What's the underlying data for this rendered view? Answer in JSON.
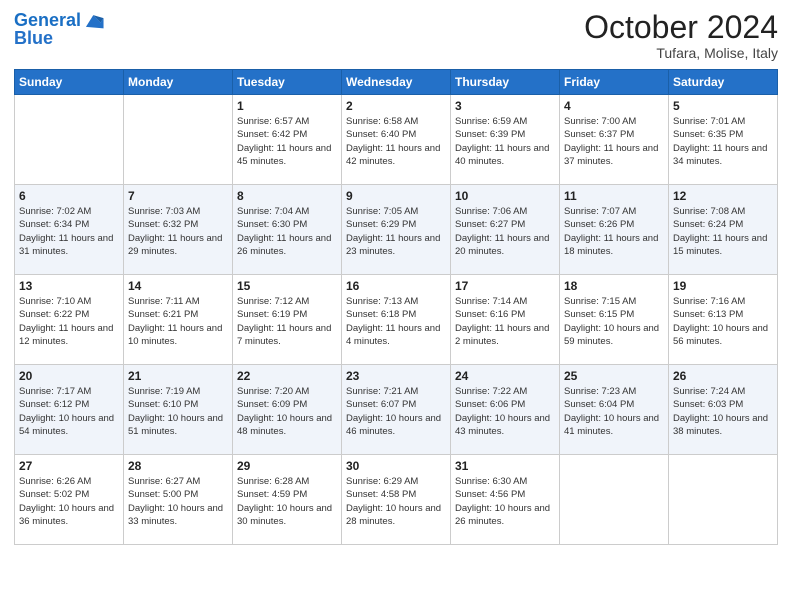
{
  "header": {
    "logo_line1": "General",
    "logo_line2": "Blue",
    "month": "October 2024",
    "location": "Tufara, Molise, Italy"
  },
  "weekdays": [
    "Sunday",
    "Monday",
    "Tuesday",
    "Wednesday",
    "Thursday",
    "Friday",
    "Saturday"
  ],
  "weeks": [
    [
      {
        "day": "",
        "sunrise": "",
        "sunset": "",
        "daylight": ""
      },
      {
        "day": "",
        "sunrise": "",
        "sunset": "",
        "daylight": ""
      },
      {
        "day": "1",
        "sunrise": "Sunrise: 6:57 AM",
        "sunset": "Sunset: 6:42 PM",
        "daylight": "Daylight: 11 hours and 45 minutes."
      },
      {
        "day": "2",
        "sunrise": "Sunrise: 6:58 AM",
        "sunset": "Sunset: 6:40 PM",
        "daylight": "Daylight: 11 hours and 42 minutes."
      },
      {
        "day": "3",
        "sunrise": "Sunrise: 6:59 AM",
        "sunset": "Sunset: 6:39 PM",
        "daylight": "Daylight: 11 hours and 40 minutes."
      },
      {
        "day": "4",
        "sunrise": "Sunrise: 7:00 AM",
        "sunset": "Sunset: 6:37 PM",
        "daylight": "Daylight: 11 hours and 37 minutes."
      },
      {
        "day": "5",
        "sunrise": "Sunrise: 7:01 AM",
        "sunset": "Sunset: 6:35 PM",
        "daylight": "Daylight: 11 hours and 34 minutes."
      }
    ],
    [
      {
        "day": "6",
        "sunrise": "Sunrise: 7:02 AM",
        "sunset": "Sunset: 6:34 PM",
        "daylight": "Daylight: 11 hours and 31 minutes."
      },
      {
        "day": "7",
        "sunrise": "Sunrise: 7:03 AM",
        "sunset": "Sunset: 6:32 PM",
        "daylight": "Daylight: 11 hours and 29 minutes."
      },
      {
        "day": "8",
        "sunrise": "Sunrise: 7:04 AM",
        "sunset": "Sunset: 6:30 PM",
        "daylight": "Daylight: 11 hours and 26 minutes."
      },
      {
        "day": "9",
        "sunrise": "Sunrise: 7:05 AM",
        "sunset": "Sunset: 6:29 PM",
        "daylight": "Daylight: 11 hours and 23 minutes."
      },
      {
        "day": "10",
        "sunrise": "Sunrise: 7:06 AM",
        "sunset": "Sunset: 6:27 PM",
        "daylight": "Daylight: 11 hours and 20 minutes."
      },
      {
        "day": "11",
        "sunrise": "Sunrise: 7:07 AM",
        "sunset": "Sunset: 6:26 PM",
        "daylight": "Daylight: 11 hours and 18 minutes."
      },
      {
        "day": "12",
        "sunrise": "Sunrise: 7:08 AM",
        "sunset": "Sunset: 6:24 PM",
        "daylight": "Daylight: 11 hours and 15 minutes."
      }
    ],
    [
      {
        "day": "13",
        "sunrise": "Sunrise: 7:10 AM",
        "sunset": "Sunset: 6:22 PM",
        "daylight": "Daylight: 11 hours and 12 minutes."
      },
      {
        "day": "14",
        "sunrise": "Sunrise: 7:11 AM",
        "sunset": "Sunset: 6:21 PM",
        "daylight": "Daylight: 11 hours and 10 minutes."
      },
      {
        "day": "15",
        "sunrise": "Sunrise: 7:12 AM",
        "sunset": "Sunset: 6:19 PM",
        "daylight": "Daylight: 11 hours and 7 minutes."
      },
      {
        "day": "16",
        "sunrise": "Sunrise: 7:13 AM",
        "sunset": "Sunset: 6:18 PM",
        "daylight": "Daylight: 11 hours and 4 minutes."
      },
      {
        "day": "17",
        "sunrise": "Sunrise: 7:14 AM",
        "sunset": "Sunset: 6:16 PM",
        "daylight": "Daylight: 11 hours and 2 minutes."
      },
      {
        "day": "18",
        "sunrise": "Sunrise: 7:15 AM",
        "sunset": "Sunset: 6:15 PM",
        "daylight": "Daylight: 10 hours and 59 minutes."
      },
      {
        "day": "19",
        "sunrise": "Sunrise: 7:16 AM",
        "sunset": "Sunset: 6:13 PM",
        "daylight": "Daylight: 10 hours and 56 minutes."
      }
    ],
    [
      {
        "day": "20",
        "sunrise": "Sunrise: 7:17 AM",
        "sunset": "Sunset: 6:12 PM",
        "daylight": "Daylight: 10 hours and 54 minutes."
      },
      {
        "day": "21",
        "sunrise": "Sunrise: 7:19 AM",
        "sunset": "Sunset: 6:10 PM",
        "daylight": "Daylight: 10 hours and 51 minutes."
      },
      {
        "day": "22",
        "sunrise": "Sunrise: 7:20 AM",
        "sunset": "Sunset: 6:09 PM",
        "daylight": "Daylight: 10 hours and 48 minutes."
      },
      {
        "day": "23",
        "sunrise": "Sunrise: 7:21 AM",
        "sunset": "Sunset: 6:07 PM",
        "daylight": "Daylight: 10 hours and 46 minutes."
      },
      {
        "day": "24",
        "sunrise": "Sunrise: 7:22 AM",
        "sunset": "Sunset: 6:06 PM",
        "daylight": "Daylight: 10 hours and 43 minutes."
      },
      {
        "day": "25",
        "sunrise": "Sunrise: 7:23 AM",
        "sunset": "Sunset: 6:04 PM",
        "daylight": "Daylight: 10 hours and 41 minutes."
      },
      {
        "day": "26",
        "sunrise": "Sunrise: 7:24 AM",
        "sunset": "Sunset: 6:03 PM",
        "daylight": "Daylight: 10 hours and 38 minutes."
      }
    ],
    [
      {
        "day": "27",
        "sunrise": "Sunrise: 6:26 AM",
        "sunset": "Sunset: 5:02 PM",
        "daylight": "Daylight: 10 hours and 36 minutes."
      },
      {
        "day": "28",
        "sunrise": "Sunrise: 6:27 AM",
        "sunset": "Sunset: 5:00 PM",
        "daylight": "Daylight: 10 hours and 33 minutes."
      },
      {
        "day": "29",
        "sunrise": "Sunrise: 6:28 AM",
        "sunset": "Sunset: 4:59 PM",
        "daylight": "Daylight: 10 hours and 30 minutes."
      },
      {
        "day": "30",
        "sunrise": "Sunrise: 6:29 AM",
        "sunset": "Sunset: 4:58 PM",
        "daylight": "Daylight: 10 hours and 28 minutes."
      },
      {
        "day": "31",
        "sunrise": "Sunrise: 6:30 AM",
        "sunset": "Sunset: 4:56 PM",
        "daylight": "Daylight: 10 hours and 26 minutes."
      },
      {
        "day": "",
        "sunrise": "",
        "sunset": "",
        "daylight": ""
      },
      {
        "day": "",
        "sunrise": "",
        "sunset": "",
        "daylight": ""
      }
    ]
  ]
}
